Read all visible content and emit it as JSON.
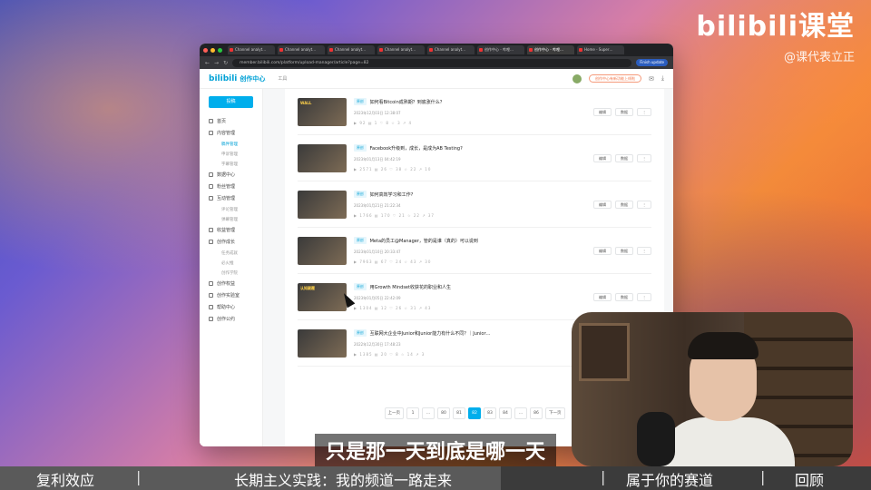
{
  "brand": {
    "logo": "bilibili课堂",
    "handle": "@课代表立正"
  },
  "browser": {
    "tabs": [
      "Channel analyt…",
      "Channel analyt…",
      "Channel analyt…",
      "Channel analyt…",
      "Channel analyt…",
      "创作中心 - 哔哩…",
      "创作中心 - 哔哩…",
      "Home - Super…"
    ],
    "url": "member.bilibili.com/platform/upload-manager/article?page=82",
    "update_label": "Finish update"
  },
  "app": {
    "logo": "bilibili",
    "title": "创作中心",
    "pc_label": "工具",
    "notice_pill": "创作中心有新功能上线啦"
  },
  "sidebar": {
    "upload_label": "投稿",
    "items": [
      {
        "label": "首页",
        "type": "main"
      },
      {
        "label": "内容管理",
        "type": "main"
      },
      {
        "label": "稿件管理",
        "type": "sub",
        "active": true
      },
      {
        "label": "申诉管理",
        "type": "sub"
      },
      {
        "label": "字幕管理",
        "type": "sub"
      },
      {
        "label": "数据中心",
        "type": "main"
      },
      {
        "label": "粉丝管理",
        "type": "main"
      },
      {
        "label": "互动管理",
        "type": "main"
      },
      {
        "label": "评论管理",
        "type": "sub"
      },
      {
        "label": "弹幕管理",
        "type": "sub"
      },
      {
        "label": "收益管理",
        "type": "main"
      },
      {
        "label": "创作成长",
        "type": "main"
      },
      {
        "label": "任务成就",
        "type": "sub"
      },
      {
        "label": "必火推",
        "type": "sub"
      },
      {
        "label": "创作学院",
        "type": "sub"
      },
      {
        "label": "创作权益",
        "type": "main"
      },
      {
        "label": "创作实验室",
        "type": "main"
      },
      {
        "label": "帮助中心",
        "type": "main"
      },
      {
        "label": "创作公约",
        "type": "main"
      }
    ]
  },
  "videos": [
    {
      "tag": "原创",
      "title": "如何看Bitcoin成熟期？到底涨什么？",
      "date": "2023年12月03日 12:38:07",
      "extra": "",
      "thumb": "WALL",
      "stats": "▶ 92  ▤ 1  ♡ 8  ☆ 3  ↗ 4"
    },
    {
      "tag": "原创",
      "title": "Facebook升级到，成长，是成为AB Testing?",
      "date": "2023年01月13日 04:42:19",
      "extra": "",
      "thumb": "",
      "stats": "▶ 2571  ▤ 26  ♡ 38  ☆ 22  ↗ 10"
    },
    {
      "tag": "原创",
      "title": "如何高效学习和工作?",
      "date": "2023年01月21日 21:22:34",
      "extra": "",
      "thumb": "",
      "stats": "▶ 1766  ▤ 170  ♡ 21  ☆ 22  ↗ 37"
    },
    {
      "tag": "原创",
      "title": "Meta的员工@Manager，管的是谁（真的）可以说到",
      "date": "2023年01月10日 20:33:47",
      "extra": "",
      "thumb": "",
      "stats": "▶ 7963  ▤ 67  ♡ 24  ☆ 43  ↗ 30"
    },
    {
      "tag": "原创",
      "title": "用Growth Mindset收获花的职业和人生",
      "date": "2023年01月05日 22:42:09",
      "extra": "",
      "thumb": "认知颠覆",
      "stats": "▶ 1304  ▤ 12  ♡ 26  ☆ 31  ↗ 43"
    },
    {
      "tag": "原创",
      "title": "互联网大企业中Junior和Junior能力有什么不同？｜Junior…",
      "date": "2022年12月30日 17:48:23",
      "extra": "",
      "thumb": "",
      "stats": "▶ 1385  ▤ 20  ♡ 8  ☆ 14  ↗ 3"
    }
  ],
  "ops": {
    "edit": "编辑",
    "data": "数据",
    "more": "⋮"
  },
  "pager": [
    "上一页",
    "1",
    "…",
    "80",
    "81",
    "82",
    "83",
    "84",
    "…",
    "86",
    "下一页"
  ],
  "pager_current": "82",
  "subtitle": "只是那一天到底是哪一天",
  "chapters": [
    "复利效应",
    "长期主义实践：我的频道一路走来",
    "属于你的赛道",
    "回顾"
  ],
  "progress_fraction": 0.575
}
